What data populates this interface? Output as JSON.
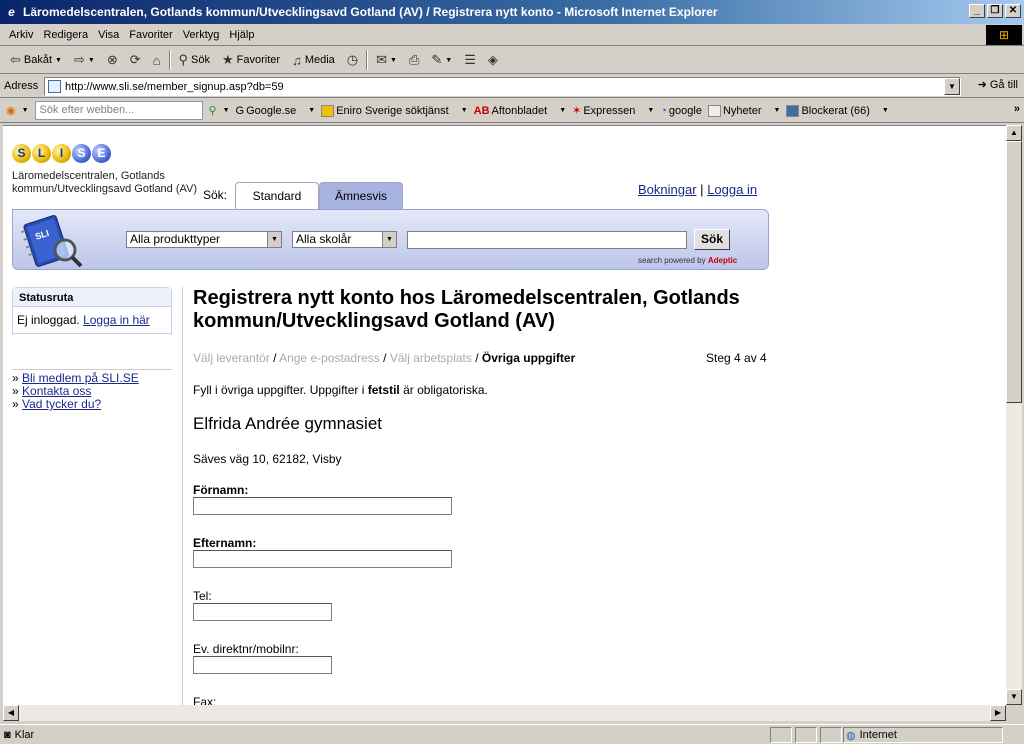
{
  "window": {
    "title": "Läromedelscentralen, Gotlands kommun/Utvecklingsavd Gotland (AV) / Registrera nytt konto - Microsoft Internet Explorer"
  },
  "menu": [
    "Arkiv",
    "Redigera",
    "Visa",
    "Favoriter",
    "Verktyg",
    "Hjälp"
  ],
  "toolbar": {
    "back": "Bakåt",
    "search": "Sök",
    "favorites": "Favoriter",
    "media": "Media"
  },
  "address": {
    "label": "Adress",
    "url": "http://www.sli.se/member_signup.asp?db=59",
    "go": "Gå till"
  },
  "links": {
    "search_placeholder": "Sök efter webben...",
    "items": [
      "Google.se",
      "Eniro Sverige söktjänst",
      "Aftonbladet",
      "Expressen",
      "google",
      "Nyheter",
      "Blockerat (66)"
    ]
  },
  "site": {
    "logo": [
      "S",
      "L",
      "I",
      "S",
      "E"
    ],
    "org_name": "Läromedelscentralen, Gotlands kommun/Utvecklingsavd Gotland (AV)",
    "search_label": "Sök:",
    "tabs": [
      "Standard",
      "Ämnesvis"
    ],
    "top_links": {
      "bookings": "Bokningar",
      "separator": "|",
      "login": "Logga in"
    },
    "product_select": "Alla produkttyper",
    "school_select": "Alla skolår",
    "search_button": "Sök",
    "powered_by": "search powered by",
    "powered_brand": "Adeptic",
    "book_label": "SLI"
  },
  "sidebar": {
    "status_title": "Statusruta",
    "status_text": "Ej inloggad.",
    "status_link": "Logga in här",
    "links": [
      "Bli medlem på SLI.SE",
      "Kontakta oss",
      "Vad tycker du?"
    ]
  },
  "main": {
    "heading": "Registrera nytt konto hos Läromedelscentralen, Gotlands kommun/Utvecklingsavd Gotland (AV)",
    "crumbs": [
      "Välj leverantör",
      "Ange e-postadress",
      "Välj arbetsplats",
      "Övriga uppgifter"
    ],
    "step": "Steg 4 av 4",
    "intro_pre": "Fyll i övriga uppgifter. Uppgifter i",
    "intro_bold": "fetstil",
    "intro_post": "är obligatoriska.",
    "school_name": "Elfrida Andrée gymnasiet",
    "school_address": "Säves väg 10, 62182, Visby",
    "fields": {
      "firstname": "Förnamn:",
      "lastname": "Efternamn:",
      "phone": "Tel:",
      "mobile": "Ev. direktnr/mobilnr:",
      "fax": "Fax:"
    }
  },
  "status": {
    "text": "Klar",
    "zone": "Internet"
  }
}
